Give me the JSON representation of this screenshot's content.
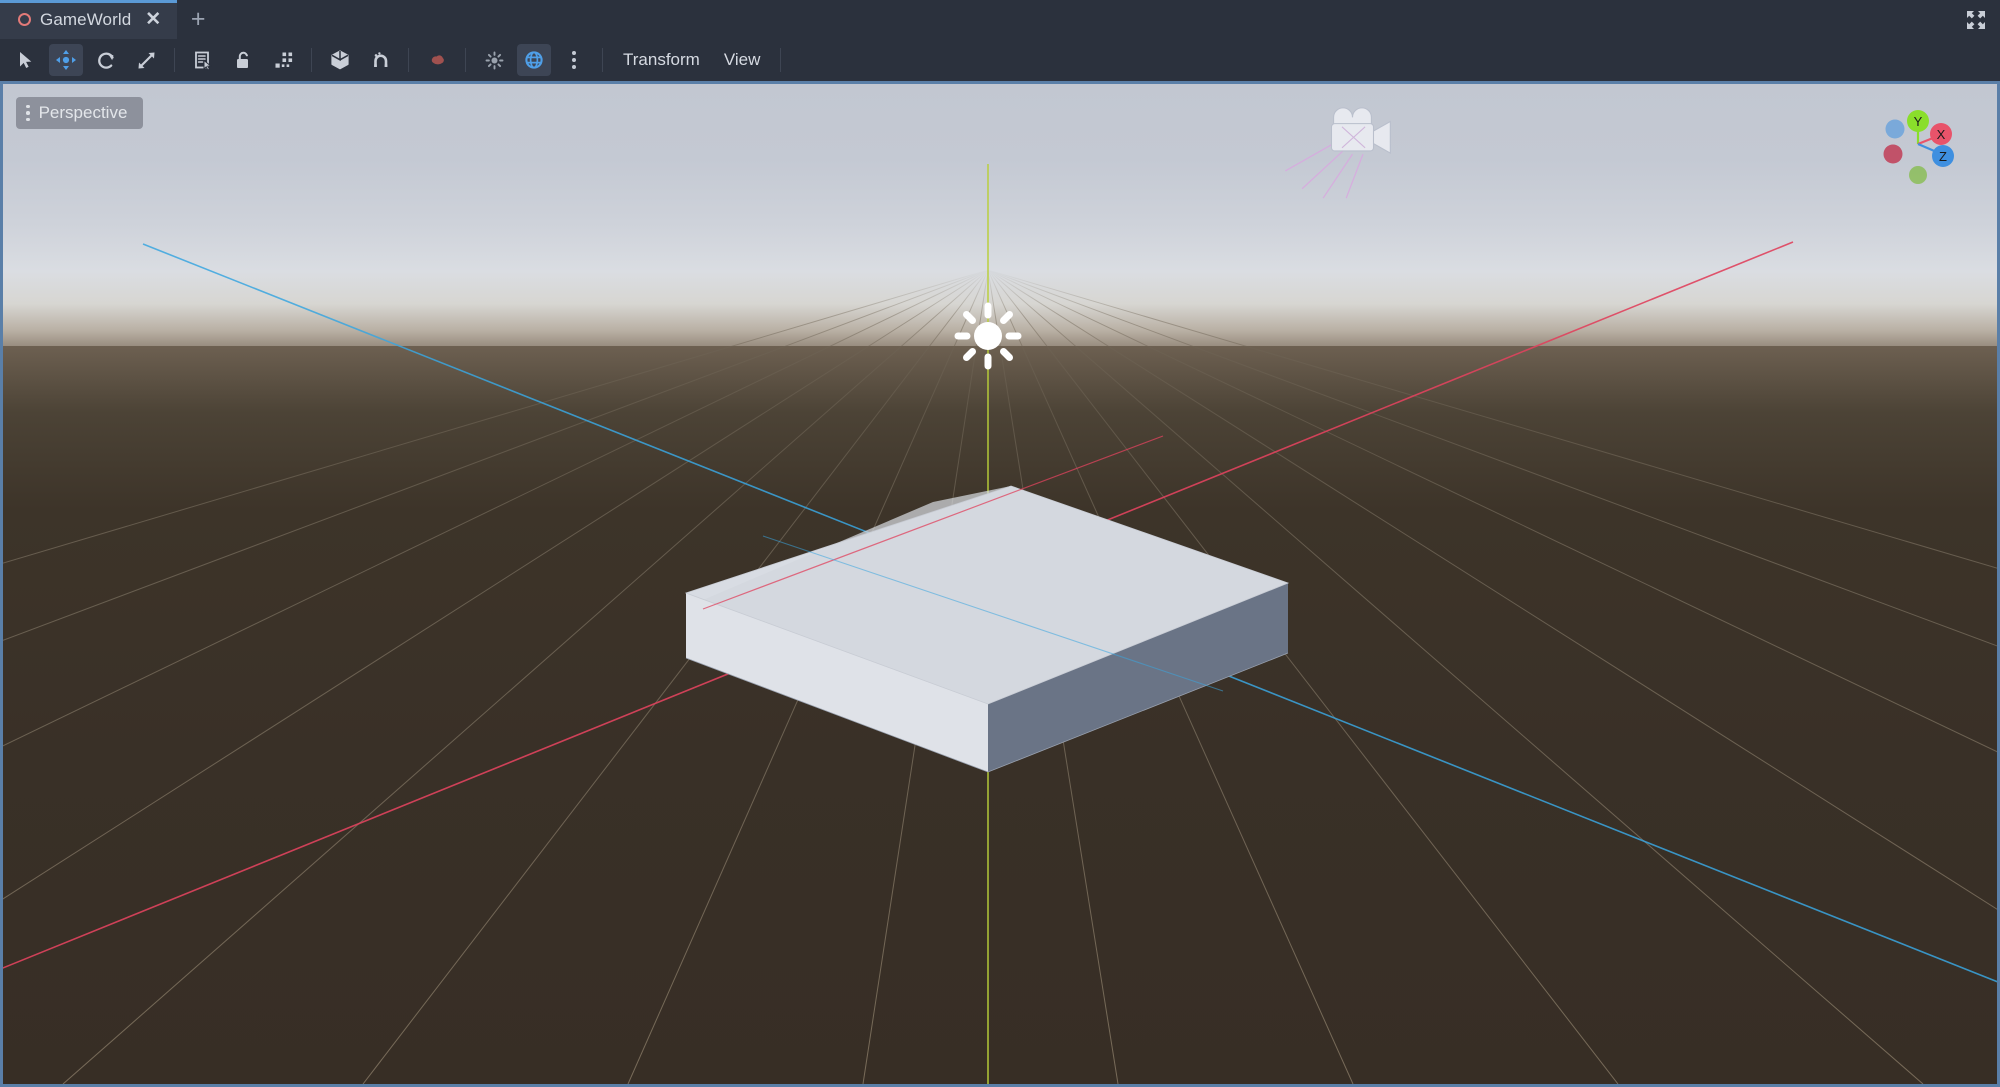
{
  "window": {
    "expand_icon": "expand-arrows-icon"
  },
  "tabs": {
    "add_label": "+",
    "items": [
      {
        "label": "GameWorld",
        "icon": "scene-circle-icon",
        "close_label": "✕",
        "active": true
      }
    ]
  },
  "toolbar": {
    "tools": [
      {
        "name": "select-tool",
        "icon": "cursor-arrow-icon",
        "active": false
      },
      {
        "name": "move-tool",
        "icon": "move-arrows-icon",
        "active": true
      },
      {
        "name": "rotate-tool",
        "icon": "rotate-icon",
        "active": false
      },
      {
        "name": "scale-tool",
        "icon": "scale-arrows-icon",
        "active": false
      },
      {
        "name": "list-select-tool",
        "icon": "list-select-icon",
        "active": false
      },
      {
        "name": "lock-tool",
        "icon": "unlock-padlock-icon",
        "active": false
      },
      {
        "name": "group-tool",
        "icon": "group-nodes-icon",
        "active": false
      },
      {
        "name": "local-space-tool",
        "icon": "cube-icon",
        "active": false
      },
      {
        "name": "snap-tool",
        "icon": "magnet-icon",
        "active": false
      },
      {
        "name": "ruler-tool",
        "icon": "blob-icon",
        "active": false
      },
      {
        "name": "light-preview-tool",
        "icon": "sun-small-icon",
        "active": false
      },
      {
        "name": "world-space-tool",
        "icon": "globe-icon",
        "active": true
      },
      {
        "name": "more-options",
        "icon": "vertical-dots-icon",
        "active": false
      }
    ],
    "menus": [
      {
        "label": "Transform"
      },
      {
        "label": "View"
      }
    ]
  },
  "viewport": {
    "perspective_button": {
      "label": "Perspective",
      "menu_icon": "vertical-dots-icon"
    },
    "gizmo": {
      "axes": [
        {
          "label": "Y",
          "color": "#8ade2b"
        },
        {
          "label": "X",
          "color": "#e8536a"
        },
        {
          "label": "Z",
          "color": "#3e8fe0"
        }
      ],
      "negative_axes": [
        {
          "label": "",
          "color": "#3e8fe0"
        },
        {
          "label": "",
          "color": "#c02a46"
        },
        {
          "label": "",
          "color": "#74b82a"
        }
      ]
    },
    "gizmos": [
      {
        "name": "camera-gizmo",
        "icon": "camera-icon"
      },
      {
        "name": "directional-light-gizmo",
        "icon": "sun-icon"
      }
    ],
    "objects": [
      {
        "name": "plane-mesh",
        "type": "box",
        "top_color": "#d4d8df",
        "front_color": "#dfe2e8",
        "side_color": "#6a7486"
      }
    ],
    "colors": {
      "sky_top": "#c2c7d1",
      "haze": "#d7d6d2",
      "ground": "#393027",
      "grid_line": "#5c5143",
      "axis_x": "#e0435e",
      "axis_y": "#b9cf39",
      "axis_z": "#3aa6e0",
      "focus_border": "#5a7fa8",
      "chrome": "#2b313d",
      "tab_active": "#353c4a",
      "accent": "#5b9ad6"
    }
  }
}
